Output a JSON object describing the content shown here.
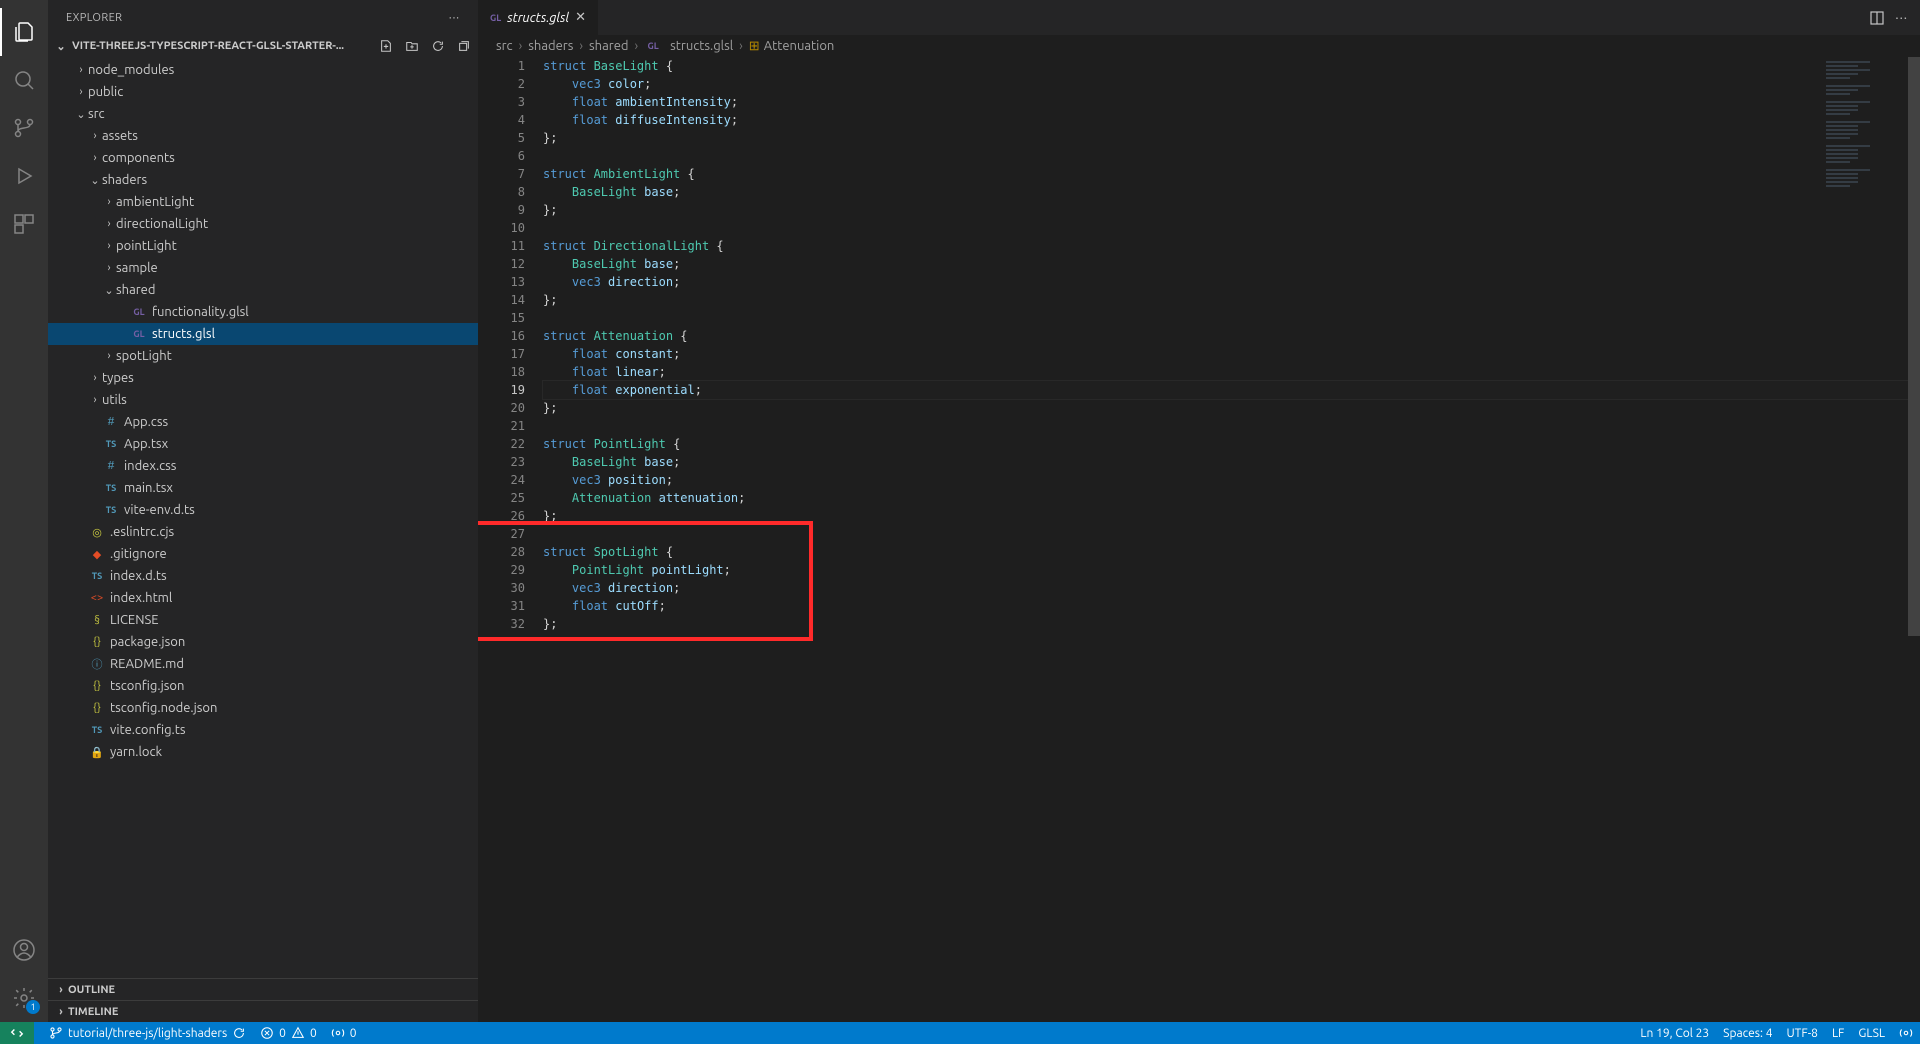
{
  "sidebar": {
    "title": "EXPLORER",
    "project": "VITE-THREEJS-TYPESCRIPT-REACT-GLSL-STARTER-...",
    "outline": "OUTLINE",
    "timeline": "TIMELINE"
  },
  "tree": [
    {
      "depth": 1,
      "tw": ">",
      "icon": "",
      "name": "node_modules",
      "kind": "folder"
    },
    {
      "depth": 1,
      "tw": ">",
      "icon": "",
      "name": "public",
      "kind": "folder"
    },
    {
      "depth": 1,
      "tw": "v",
      "icon": "",
      "name": "src",
      "kind": "folder"
    },
    {
      "depth": 2,
      "tw": ">",
      "icon": "",
      "name": "assets",
      "kind": "folder"
    },
    {
      "depth": 2,
      "tw": ">",
      "icon": "",
      "name": "components",
      "kind": "folder"
    },
    {
      "depth": 2,
      "tw": "v",
      "icon": "",
      "name": "shaders",
      "kind": "folder"
    },
    {
      "depth": 3,
      "tw": ">",
      "icon": "",
      "name": "ambientLight",
      "kind": "folder"
    },
    {
      "depth": 3,
      "tw": ">",
      "icon": "",
      "name": "directionalLight",
      "kind": "folder"
    },
    {
      "depth": 3,
      "tw": ">",
      "icon": "",
      "name": "pointLight",
      "kind": "folder"
    },
    {
      "depth": 3,
      "tw": ">",
      "icon": "",
      "name": "sample",
      "kind": "folder"
    },
    {
      "depth": 3,
      "tw": "v",
      "icon": "",
      "name": "shared",
      "kind": "folder"
    },
    {
      "depth": 4,
      "tw": "",
      "icon": "GL",
      "iclass": "ic-gl",
      "name": "functionality.glsl",
      "kind": "file"
    },
    {
      "depth": 4,
      "tw": "",
      "icon": "GL",
      "iclass": "ic-gl",
      "name": "structs.glsl",
      "kind": "file",
      "selected": true
    },
    {
      "depth": 3,
      "tw": ">",
      "icon": "",
      "name": "spotLight",
      "kind": "folder"
    },
    {
      "depth": 2,
      "tw": ">",
      "icon": "",
      "name": "types",
      "kind": "folder"
    },
    {
      "depth": 2,
      "tw": ">",
      "icon": "",
      "name": "utils",
      "kind": "folder"
    },
    {
      "depth": 2,
      "tw": "",
      "icon": "#",
      "iclass": "ic-hash",
      "name": "App.css",
      "kind": "file"
    },
    {
      "depth": 2,
      "tw": "",
      "icon": "TS",
      "iclass": "ic-ts",
      "name": "App.tsx",
      "kind": "file"
    },
    {
      "depth": 2,
      "tw": "",
      "icon": "#",
      "iclass": "ic-hash",
      "name": "index.css",
      "kind": "file"
    },
    {
      "depth": 2,
      "tw": "",
      "icon": "TS",
      "iclass": "ic-ts",
      "name": "main.tsx",
      "kind": "file"
    },
    {
      "depth": 2,
      "tw": "",
      "icon": "TS",
      "iclass": "ic-ts",
      "name": "vite-env.d.ts",
      "kind": "file"
    },
    {
      "depth": 1,
      "tw": "",
      "icon": "◎",
      "iclass": "ic-js",
      "name": ".eslintrc.cjs",
      "kind": "file"
    },
    {
      "depth": 1,
      "tw": "",
      "icon": "◆",
      "iclass": "ic-git",
      "name": ".gitignore",
      "kind": "file"
    },
    {
      "depth": 1,
      "tw": "",
      "icon": "TS",
      "iclass": "ic-ts",
      "name": "index.d.ts",
      "kind": "file"
    },
    {
      "depth": 1,
      "tw": "",
      "icon": "<>",
      "iclass": "ic-html",
      "name": "index.html",
      "kind": "file"
    },
    {
      "depth": 1,
      "tw": "",
      "icon": "§",
      "iclass": "ic-cert",
      "name": "LICENSE",
      "kind": "file"
    },
    {
      "depth": 1,
      "tw": "",
      "icon": "{}",
      "iclass": "ic-json",
      "name": "package.json",
      "kind": "file"
    },
    {
      "depth": 1,
      "tw": "",
      "icon": "ⓘ",
      "iclass": "ic-info",
      "name": "README.md",
      "kind": "file"
    },
    {
      "depth": 1,
      "tw": "",
      "icon": "{}",
      "iclass": "ic-json",
      "name": "tsconfig.json",
      "kind": "file"
    },
    {
      "depth": 1,
      "tw": "",
      "icon": "{}",
      "iclass": "ic-json",
      "name": "tsconfig.node.json",
      "kind": "file"
    },
    {
      "depth": 1,
      "tw": "",
      "icon": "TS",
      "iclass": "ic-ts",
      "name": "vite.config.ts",
      "kind": "file"
    },
    {
      "depth": 1,
      "tw": "",
      "icon": "🔒",
      "iclass": "ic-lock",
      "name": "yarn.lock",
      "kind": "file"
    }
  ],
  "tab": {
    "prefix": "GL",
    "name": "structs.glsl"
  },
  "tabs_actions": {
    "split": "▯▯",
    "more": "···"
  },
  "breadcrumbs": [
    "src",
    "shaders",
    "shared",
    "structs.glsl",
    "Attenuation"
  ],
  "breadcrumb_file_prefix": "GL",
  "breadcrumb_symbol_icon": "⊞",
  "code": {
    "current_line": 19,
    "lines": [
      {
        "n": 1,
        "t": [
          [
            "struct ",
            "k"
          ],
          [
            "BaseLight ",
            "t"
          ],
          [
            "{",
            "p"
          ]
        ]
      },
      {
        "n": 2,
        "t": [
          [
            "    ",
            "g"
          ],
          [
            "vec3 ",
            "k"
          ],
          [
            "color",
            "f"
          ],
          [
            ";",
            "p"
          ]
        ]
      },
      {
        "n": 3,
        "t": [
          [
            "    ",
            "g"
          ],
          [
            "float ",
            "k"
          ],
          [
            "ambientIntensity",
            "f"
          ],
          [
            ";",
            "p"
          ]
        ]
      },
      {
        "n": 4,
        "t": [
          [
            "    ",
            "g"
          ],
          [
            "float ",
            "k"
          ],
          [
            "diffuseIntensity",
            "f"
          ],
          [
            ";",
            "p"
          ]
        ]
      },
      {
        "n": 5,
        "t": [
          [
            "};",
            "p"
          ]
        ]
      },
      {
        "n": 6,
        "t": []
      },
      {
        "n": 7,
        "t": [
          [
            "struct ",
            "k"
          ],
          [
            "AmbientLight ",
            "t"
          ],
          [
            "{",
            "p"
          ]
        ]
      },
      {
        "n": 8,
        "t": [
          [
            "    ",
            "g"
          ],
          [
            "BaseLight ",
            "t"
          ],
          [
            "base",
            "f"
          ],
          [
            ";",
            "p"
          ]
        ]
      },
      {
        "n": 9,
        "t": [
          [
            "};",
            "p"
          ]
        ]
      },
      {
        "n": 10,
        "t": []
      },
      {
        "n": 11,
        "t": [
          [
            "struct ",
            "k"
          ],
          [
            "DirectionalLight ",
            "t"
          ],
          [
            "{",
            "p"
          ]
        ]
      },
      {
        "n": 12,
        "t": [
          [
            "    ",
            "g"
          ],
          [
            "BaseLight ",
            "t"
          ],
          [
            "base",
            "f"
          ],
          [
            ";",
            "p"
          ]
        ]
      },
      {
        "n": 13,
        "t": [
          [
            "    ",
            "g"
          ],
          [
            "vec3 ",
            "k"
          ],
          [
            "direction",
            "f"
          ],
          [
            ";",
            "p"
          ]
        ]
      },
      {
        "n": 14,
        "t": [
          [
            "};",
            "p"
          ]
        ]
      },
      {
        "n": 15,
        "t": []
      },
      {
        "n": 16,
        "t": [
          [
            "struct ",
            "k"
          ],
          [
            "Attenuation ",
            "t"
          ],
          [
            "{",
            "p"
          ]
        ]
      },
      {
        "n": 17,
        "t": [
          [
            "    ",
            "g"
          ],
          [
            "float ",
            "k"
          ],
          [
            "constant",
            "f"
          ],
          [
            ";",
            "p"
          ]
        ]
      },
      {
        "n": 18,
        "t": [
          [
            "    ",
            "g"
          ],
          [
            "float ",
            "k"
          ],
          [
            "linear",
            "f"
          ],
          [
            ";",
            "p"
          ]
        ]
      },
      {
        "n": 19,
        "t": [
          [
            "    ",
            "g"
          ],
          [
            "float ",
            "k"
          ],
          [
            "exponential",
            "f"
          ],
          [
            ";",
            "p"
          ]
        ]
      },
      {
        "n": 20,
        "t": [
          [
            "};",
            "p"
          ]
        ]
      },
      {
        "n": 21,
        "t": []
      },
      {
        "n": 22,
        "t": [
          [
            "struct ",
            "k"
          ],
          [
            "PointLight ",
            "t"
          ],
          [
            "{",
            "p"
          ]
        ]
      },
      {
        "n": 23,
        "t": [
          [
            "    ",
            "g"
          ],
          [
            "BaseLight ",
            "t"
          ],
          [
            "base",
            "f"
          ],
          [
            ";",
            "p"
          ]
        ]
      },
      {
        "n": 24,
        "t": [
          [
            "    ",
            "g"
          ],
          [
            "vec3 ",
            "k"
          ],
          [
            "position",
            "f"
          ],
          [
            ";",
            "p"
          ]
        ]
      },
      {
        "n": 25,
        "t": [
          [
            "    ",
            "g"
          ],
          [
            "Attenuation ",
            "t"
          ],
          [
            "attenuation",
            "f"
          ],
          [
            ";",
            "p"
          ]
        ]
      },
      {
        "n": 26,
        "t": [
          [
            "};",
            "p"
          ]
        ]
      },
      {
        "n": 27,
        "t": []
      },
      {
        "n": 28,
        "t": [
          [
            "struct ",
            "k"
          ],
          [
            "SpotLight ",
            "t"
          ],
          [
            "{",
            "p"
          ]
        ]
      },
      {
        "n": 29,
        "t": [
          [
            "    ",
            "g"
          ],
          [
            "PointLight ",
            "t"
          ],
          [
            "pointLight",
            "f"
          ],
          [
            ";",
            "p"
          ]
        ]
      },
      {
        "n": 30,
        "t": [
          [
            "    ",
            "g"
          ],
          [
            "vec3 ",
            "k"
          ],
          [
            "direction",
            "f"
          ],
          [
            ";",
            "p"
          ]
        ]
      },
      {
        "n": 31,
        "t": [
          [
            "    ",
            "g"
          ],
          [
            "float ",
            "k"
          ],
          [
            "cutOff",
            "f"
          ],
          [
            ";",
            "p"
          ]
        ]
      },
      {
        "n": 32,
        "t": [
          [
            "};",
            "p"
          ]
        ]
      }
    ],
    "highlight": {
      "top_line": 27,
      "bottom_line": 32
    }
  },
  "status": {
    "branch": "tutorial/three-js/light-shaders",
    "errors": "0",
    "warnings": "0",
    "ports": "0",
    "cursor": "Ln 19, Col 23",
    "spaces": "Spaces: 4",
    "encoding": "UTF-8",
    "eol": "LF",
    "lang": "GLSL"
  },
  "settings_badge": "1"
}
